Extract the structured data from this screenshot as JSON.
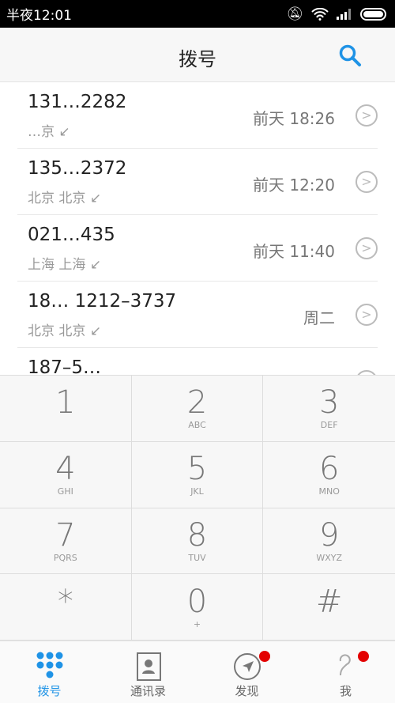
{
  "status_bar": {
    "time": "半夜12:01"
  },
  "header": {
    "title": "拨号"
  },
  "calls": [
    {
      "number": "131…2282",
      "location": "…京",
      "time": "前天  18:26"
    },
    {
      "number": "135…2372",
      "location": "北京 北京",
      "time": "前天  12:20"
    },
    {
      "number": "021…435",
      "location": "上海 上海",
      "time": "前天  11:40"
    },
    {
      "number": "18… 1212–3737",
      "location": "北京 北京",
      "time": "周二"
    },
    {
      "number": "187–5…",
      "location": "",
      "time": ""
    }
  ],
  "keypad": [
    {
      "digit": "1",
      "letters": ""
    },
    {
      "digit": "2",
      "letters": "ABC"
    },
    {
      "digit": "3",
      "letters": "DEF"
    },
    {
      "digit": "4",
      "letters": "GHI"
    },
    {
      "digit": "5",
      "letters": "JKL"
    },
    {
      "digit": "6",
      "letters": "MNO"
    },
    {
      "digit": "7",
      "letters": "PQRS"
    },
    {
      "digit": "8",
      "letters": "TUV"
    },
    {
      "digit": "9",
      "letters": "WXYZ"
    },
    {
      "digit": "*",
      "letters": ""
    },
    {
      "digit": "0",
      "letters": "+"
    },
    {
      "digit": "#",
      "letters": ""
    }
  ],
  "nav": [
    {
      "label": "拨号",
      "active": true
    },
    {
      "label": "通讯录"
    },
    {
      "label": "发现",
      "badge": true
    },
    {
      "label": "我",
      "badge": true
    }
  ],
  "colors": {
    "accent": "#1f93e6",
    "badge": "#e30000"
  }
}
